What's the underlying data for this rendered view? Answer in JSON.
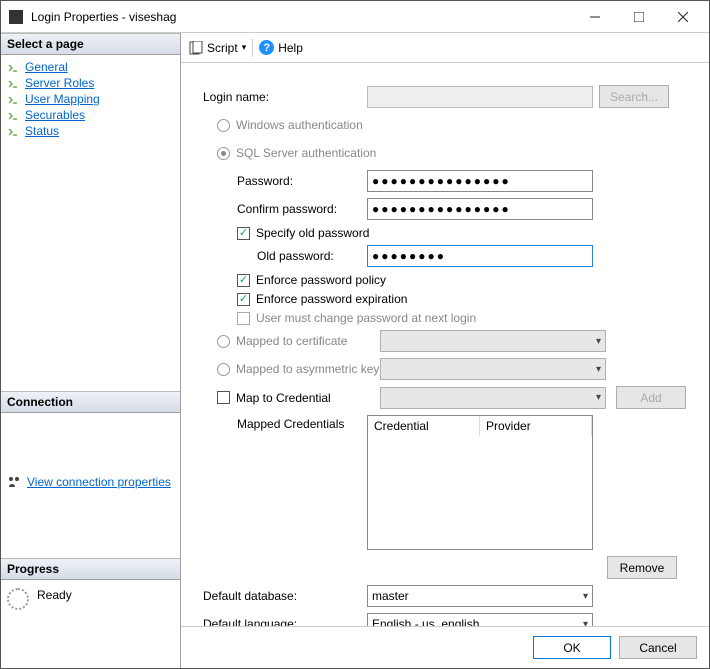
{
  "window": {
    "title": "Login Properties - viseshag"
  },
  "left": {
    "select_page": "Select a page",
    "pages": [
      "General",
      "Server Roles",
      "User Mapping",
      "Securables",
      "Status"
    ],
    "connection": "Connection",
    "view_conn": "View connection properties",
    "progress": "Progress",
    "ready": "Ready"
  },
  "toolbar": {
    "script": "Script",
    "help": "Help"
  },
  "main": {
    "login_name": "Login name:",
    "search": "Search...",
    "win_auth": "Windows authentication",
    "sql_auth": "SQL Server authentication",
    "password": "Password:",
    "confirm": "Confirm password:",
    "specify_old": "Specify old password",
    "old_pwd": "Old password:",
    "enforce_policy": "Enforce password policy",
    "enforce_exp": "Enforce password expiration",
    "must_change": "User must change password at next login",
    "mapped_cert": "Mapped to certificate",
    "mapped_akey": "Mapped to asymmetric key",
    "map_cred": "Map to Credential",
    "add": "Add",
    "mapped_creds": "Mapped Credentials",
    "col_cred": "Credential",
    "col_prov": "Provider",
    "remove": "Remove",
    "def_db": "Default database:",
    "db_val": "master",
    "def_lang": "Default language:",
    "lang_val": "English - us_english",
    "pwd_value": "●●●●●●●●●●●●●●●",
    "old_value": "●●●●●●●●"
  },
  "buttons": {
    "ok": "OK",
    "cancel": "Cancel"
  }
}
